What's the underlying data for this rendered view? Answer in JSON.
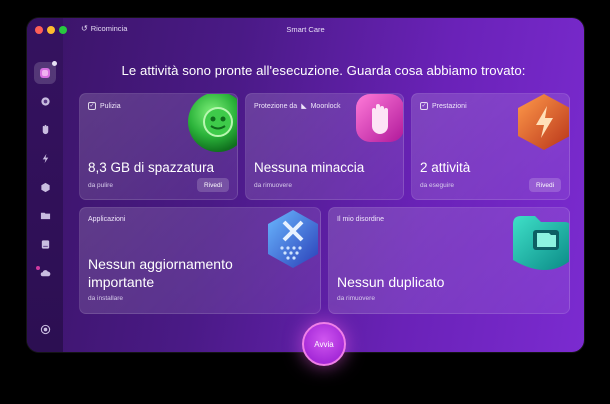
{
  "titlebar": {
    "title": "Smart Care",
    "restart_label": "Ricomincia"
  },
  "headline": "Le attività sono pronte all'esecuzione. Guarda cosa abbiamo trovato:",
  "cards": {
    "cleanup": {
      "label": "Pulizia",
      "main": "8,3 GB di spazzatura",
      "sub": "da pulire",
      "button": "Rivedi"
    },
    "protection": {
      "label": "Protezione da",
      "brand": "Moonlock",
      "main": "Nessuna minaccia",
      "sub": "da rimuovere"
    },
    "performance": {
      "label": "Prestazioni",
      "main": "2 attività",
      "sub": "da eseguire",
      "button": "Rivedi"
    },
    "applications": {
      "label": "Applicazioni",
      "main_line1": "Nessun aggiornamento",
      "main_line2": "importante",
      "sub": "da installare"
    },
    "clutter": {
      "label": "Il mio disordine",
      "main": "Nessun duplicato",
      "sub": "da rimuovere"
    }
  },
  "run_button": "Avvia",
  "colors": {
    "accent": "#c040e8",
    "window_bg": "#4a1a86"
  }
}
